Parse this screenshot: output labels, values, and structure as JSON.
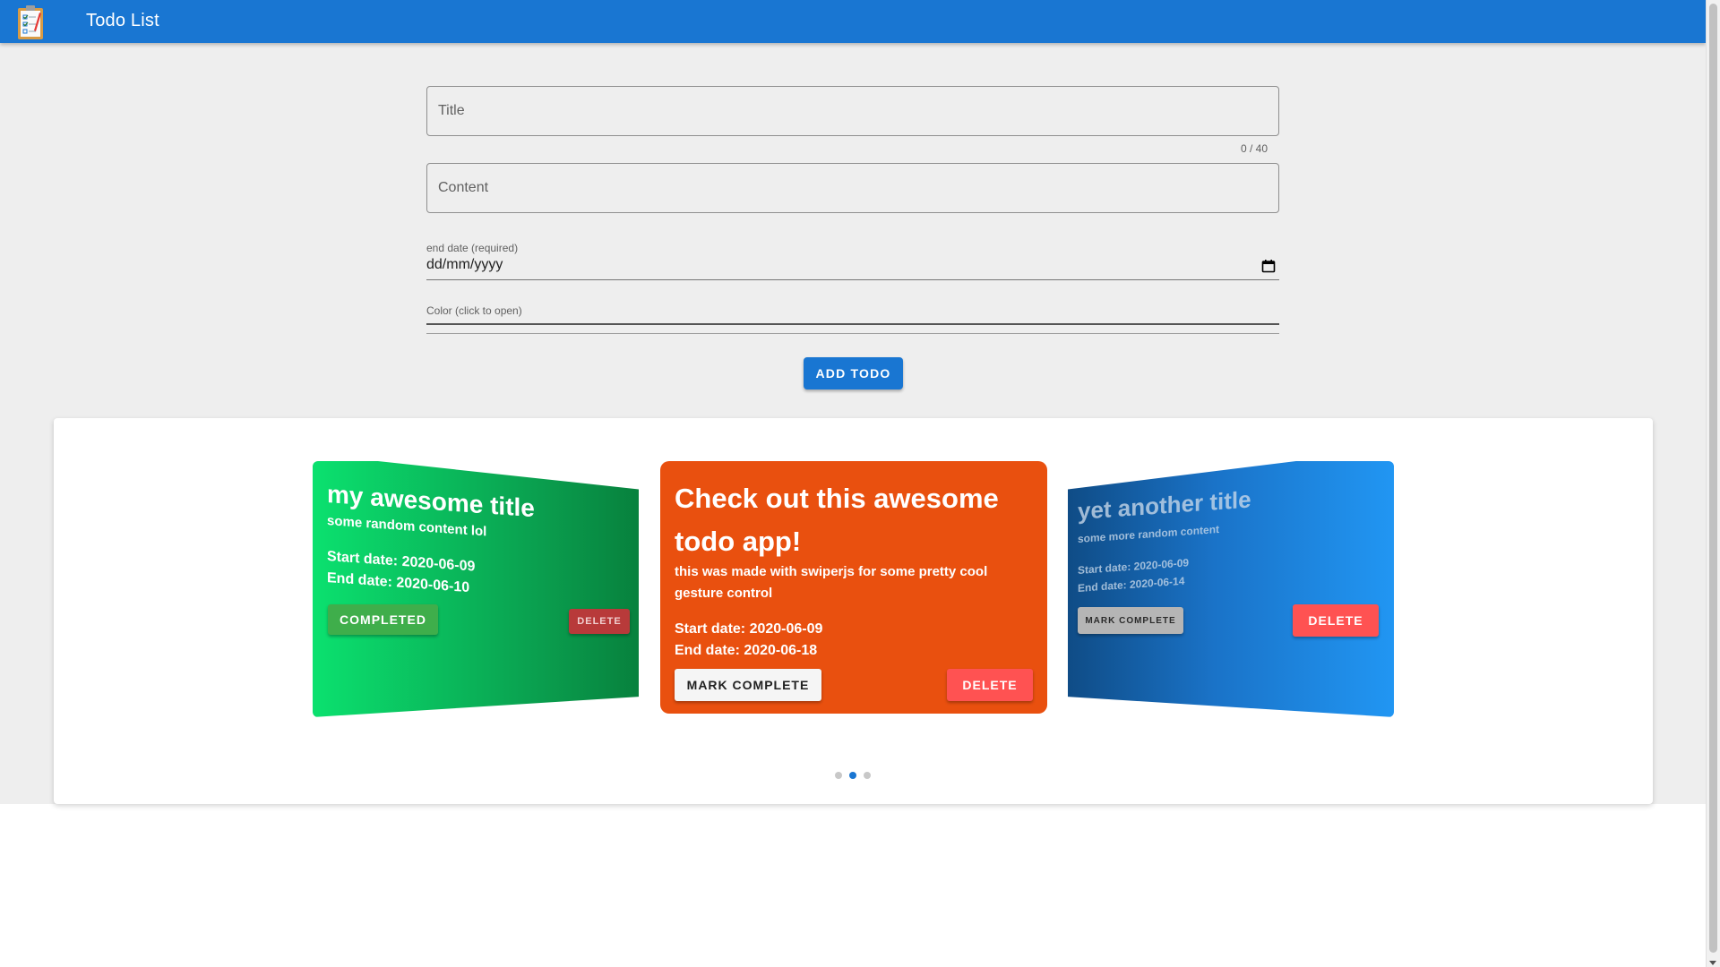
{
  "app": {
    "title": "Todo List",
    "accent": "#1976d2"
  },
  "form": {
    "title_placeholder": "Title",
    "title_counter": "0 / 40",
    "content_placeholder": "Content",
    "date_label": "end date (required)",
    "date_value": "dd/mm/yyyy",
    "color_label": "Color (click to open)",
    "add_label": "ADD TODO"
  },
  "cards": [
    {
      "title": "my awesome title",
      "content": "some random content lol",
      "start": "Start date: 2020-06-09",
      "end": "End date: 2020-06-10",
      "action_label": "COMPLETED",
      "delete_label": "DELETE",
      "color": "#0be16f"
    },
    {
      "title": "Check out this awesome todo app!",
      "content": "this was made with swiperjs for some pretty cool gesture control",
      "start": "Start date: 2020-06-09",
      "end": "End date: 2020-06-18",
      "action_label": "MARK COMPLETE",
      "delete_label": "DELETE",
      "color": "#e9500f"
    },
    {
      "title": "yet another title",
      "content": "some more random content",
      "start": "Start date: 2020-06-09",
      "end": "End date: 2020-06-14",
      "action_label": "MARK COMPLETE",
      "delete_label": "DELETE",
      "color": "#2196f3"
    }
  ],
  "pagination": {
    "active_index": 1,
    "count": 3
  }
}
